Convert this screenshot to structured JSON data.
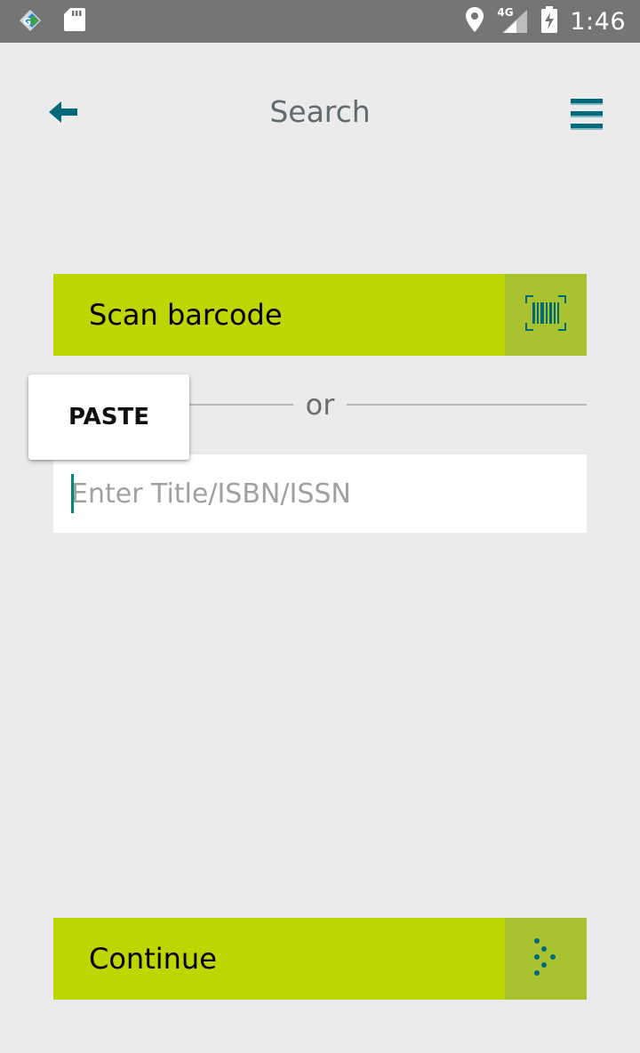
{
  "status_bar": {
    "time": "1:46",
    "network": "4G",
    "icons": [
      "app-notification-icon",
      "sd-card-icon",
      "location-icon",
      "signal-icon",
      "battery-charging-icon"
    ]
  },
  "header": {
    "title": "Search",
    "back_icon": "back-arrow-icon",
    "menu_icon": "hamburger-menu-icon"
  },
  "scan": {
    "label": "Scan barcode",
    "icon": "barcode-scan-icon"
  },
  "divider": {
    "text": "or"
  },
  "search": {
    "value": "",
    "placeholder": "Enter Title/ISBN/ISSN"
  },
  "paste_popup": {
    "label": "PASTE"
  },
  "continue": {
    "label": "Continue",
    "icon": "continue-dots-arrow-icon"
  },
  "colors": {
    "accent_green": "#bed600",
    "icon_box_green": "#a9c230",
    "teal": "#00697a",
    "status_bar": "#757575",
    "background": "#ebebeb"
  }
}
